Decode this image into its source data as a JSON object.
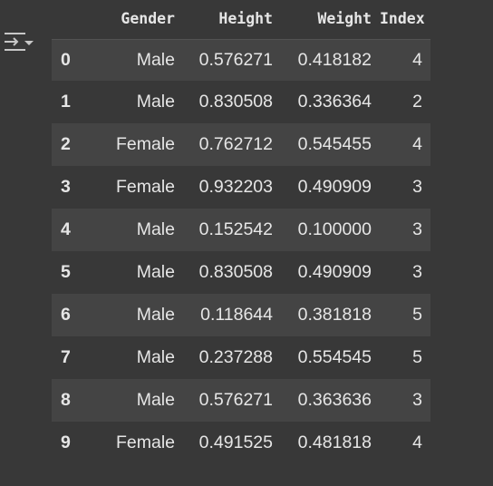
{
  "output_toolbar": {
    "icon": "output-options-icon"
  },
  "dataframe": {
    "columns": [
      "Gender",
      "Height",
      "Weight",
      "Index"
    ],
    "rows": [
      {
        "index": "0",
        "cells": [
          "Male",
          "0.576271",
          "0.418182",
          "4"
        ]
      },
      {
        "index": "1",
        "cells": [
          "Male",
          "0.830508",
          "0.336364",
          "2"
        ]
      },
      {
        "index": "2",
        "cells": [
          "Female",
          "0.762712",
          "0.545455",
          "4"
        ]
      },
      {
        "index": "3",
        "cells": [
          "Female",
          "0.932203",
          "0.490909",
          "3"
        ]
      },
      {
        "index": "4",
        "cells": [
          "Male",
          "0.152542",
          "0.100000",
          "3"
        ]
      },
      {
        "index": "5",
        "cells": [
          "Male",
          "0.830508",
          "0.490909",
          "3"
        ]
      },
      {
        "index": "6",
        "cells": [
          "Male",
          "0.118644",
          "0.381818",
          "5"
        ]
      },
      {
        "index": "7",
        "cells": [
          "Male",
          "0.237288",
          "0.554545",
          "5"
        ]
      },
      {
        "index": "8",
        "cells": [
          "Male",
          "0.576271",
          "0.363636",
          "3"
        ]
      },
      {
        "index": "9",
        "cells": [
          "Female",
          "0.491525",
          "0.481818",
          "4"
        ]
      }
    ]
  }
}
